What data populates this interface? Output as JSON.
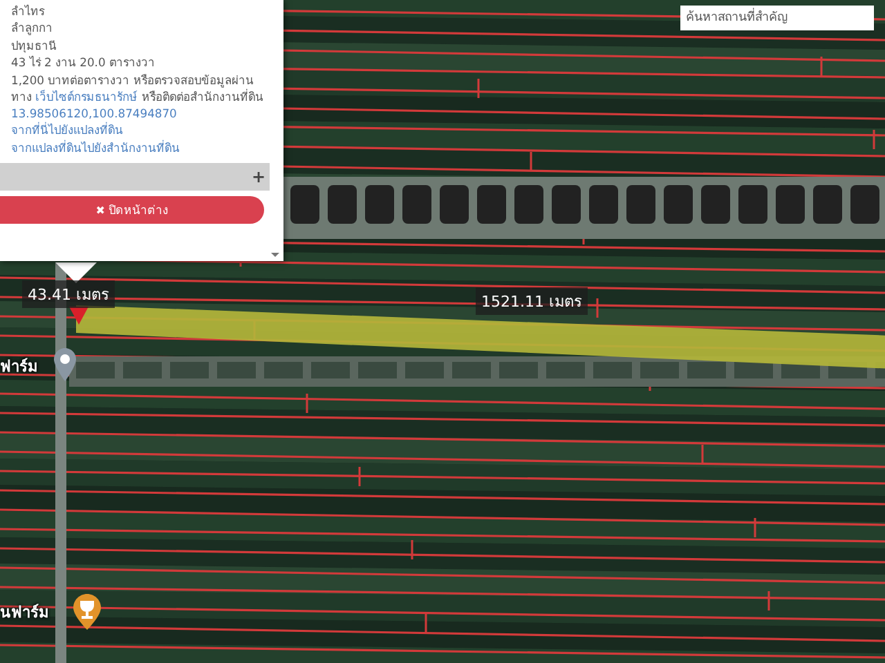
{
  "search": {
    "placeholder": "ค้นหาสถานที่สำคัญ"
  },
  "popup": {
    "lines": [
      "ลำไทร",
      "ลำลูกกา",
      "ปทุมธานี",
      "43 ไร่ 2 งาน 20.0 ตารางวา"
    ],
    "price_note": {
      "before": "1,200 บาทต่อตารางวา หรือตรวจสอบข้อมูลผ่านทาง ",
      "link": "เว็บไซต์กรมธนารักษ์",
      "after": " หรือติดต่อสำนักงานที่ดิน"
    },
    "links": [
      "13.98506120,100.87494870",
      "จากที่นี่ไปยังแปลงที่ดิน",
      "จากแปลงที่ดินไปยังสำนักงานที่ดิน"
    ],
    "expand": "+",
    "close_button": {
      "icon": "✖",
      "label": "ปิดหน้าต่าง"
    }
  },
  "map": {
    "measurements": [
      {
        "text": "43.41 เมตร",
        "kind": "width"
      },
      {
        "text": "1521.11 เมตร",
        "kind": "length"
      }
    ],
    "place_labels": [
      {
        "text": "ฟาร์ม",
        "kind": "pin"
      },
      {
        "text": "นฟาร์ม",
        "kind": "trophy"
      }
    ]
  }
}
